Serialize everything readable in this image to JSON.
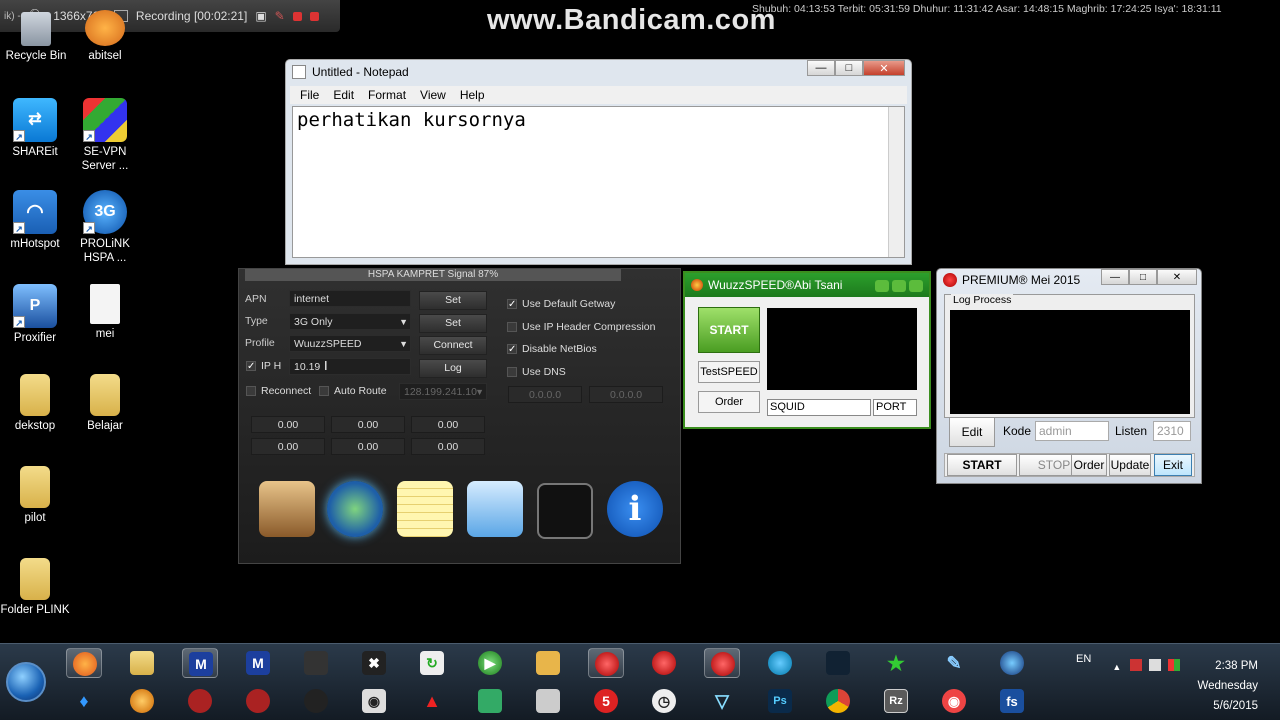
{
  "recorder": {
    "resolution": "1366x768",
    "status": "Recording [00:02:21]",
    "watermark": "www.Bandicam.com",
    "prayer_times": "Shubuh: 04:13:53 Terbit: 05:31:59 Dhuhur: 11:31:42 Asar: 14:48:15 Maghrib: 17:24:25 Isya': 18:31:11"
  },
  "desktop": {
    "icons": [
      {
        "label": "Recycle Bin",
        "icon": "recycle-bin-icon"
      },
      {
        "label": "abitsel",
        "icon": "abitsel-icon"
      },
      {
        "label": "SHAREit",
        "icon": "shareit-icon"
      },
      {
        "label": "SE-VPN Server ...",
        "icon": "se-vpn-icon"
      },
      {
        "label": "mHotspot",
        "icon": "mhotspot-icon"
      },
      {
        "label": "PROLiNK HSPA ...",
        "icon": "prolink-icon"
      },
      {
        "label": "Proxifier",
        "icon": "proxifier-icon"
      },
      {
        "label": "mei",
        "icon": "text-file-icon"
      },
      {
        "label": "dekstop",
        "icon": "folder-icon"
      },
      {
        "label": "Belajar",
        "icon": "folder-icon"
      },
      {
        "label": "pilot",
        "icon": "folder-icon"
      },
      {
        "label": "Folder PLINK",
        "icon": "folder-icon"
      }
    ]
  },
  "notepad": {
    "title": "Untitled - Notepad",
    "menu": [
      "File",
      "Edit",
      "Format",
      "View",
      "Help"
    ],
    "content": "perhatikan kursornya"
  },
  "hspa": {
    "title": "HSPA KAMPRET Signal 87%",
    "apn_label": "APN",
    "apn_value": "internet",
    "type_label": "Type",
    "type_value": "3G Only",
    "profile_label": "Profile",
    "profile_value": "WuuzzSPEED",
    "iph_label": "IP H",
    "iph_value": "10.19",
    "btn_set1": "Set",
    "btn_set2": "Set",
    "btn_connect": "Connect",
    "btn_log": "Log",
    "reconnect_label": "Reconnect",
    "autoroute_label": "Auto Route",
    "autoroute_value": "128.199.241.10",
    "options": [
      {
        "label": "Use Default Getway",
        "checked": true
      },
      {
        "label": "Use IP Header Compression",
        "checked": false
      },
      {
        "label": "Disable NetBios",
        "checked": true
      },
      {
        "label": "Use DNS",
        "checked": false
      }
    ],
    "dns1": "0.0.0.0",
    "dns2": "0.0.0.0",
    "stats": [
      "0.00",
      "0.00",
      "0.00",
      "0.00",
      "0.00",
      "0.00"
    ]
  },
  "wuuzz": {
    "title": "WuuzzSPEED®Abi Tsani",
    "start": "START",
    "testspeed": "TestSPEED",
    "order": "Order",
    "squid": "SQUID",
    "port": "PORT"
  },
  "premium": {
    "title": "PREMIUM® Mei 2015",
    "log_label": "Log Process",
    "edit": "Edit",
    "kode_label": "Kode",
    "kode_value": "admin",
    "listen_label": "Listen",
    "listen_value": "2310",
    "start": "START",
    "stop": "STOP",
    "order": "Order",
    "update": "Update",
    "exit": "Exit"
  },
  "taskbar": {
    "lang": "EN",
    "time": "2:38 PM",
    "day": "Wednesday",
    "date": "5/6/2015"
  }
}
